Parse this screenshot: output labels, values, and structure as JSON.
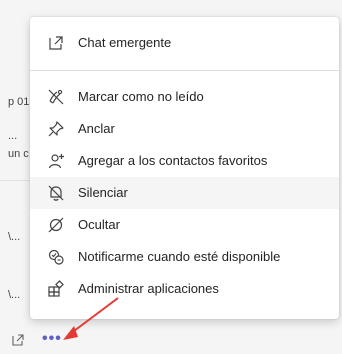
{
  "background": {
    "fragments": [
      "p 01",
      "...",
      "un c",
      "\\...",
      "\\..."
    ]
  },
  "menu": {
    "popout": {
      "label": "Chat emergente",
      "icon": "popout-icon"
    },
    "items": [
      {
        "label": "Marcar como no leído",
        "icon": "mark-unread-icon"
      },
      {
        "label": "Anclar",
        "icon": "pin-icon"
      },
      {
        "label": "Agregar a los contactos favoritos",
        "icon": "add-favorite-contact-icon"
      },
      {
        "label": "Silenciar",
        "icon": "mute-bell-icon"
      },
      {
        "label": "Ocultar",
        "icon": "hide-icon"
      },
      {
        "label": "Notificarme cuando esté disponible",
        "icon": "notify-available-icon"
      },
      {
        "label": "Administrar aplicaciones",
        "icon": "manage-apps-icon"
      }
    ]
  },
  "bottom": {
    "more_label": "•••"
  },
  "colors": {
    "accent": "#5b5fc7",
    "arrow": "#e53935",
    "hover": "#f5f5f5"
  }
}
